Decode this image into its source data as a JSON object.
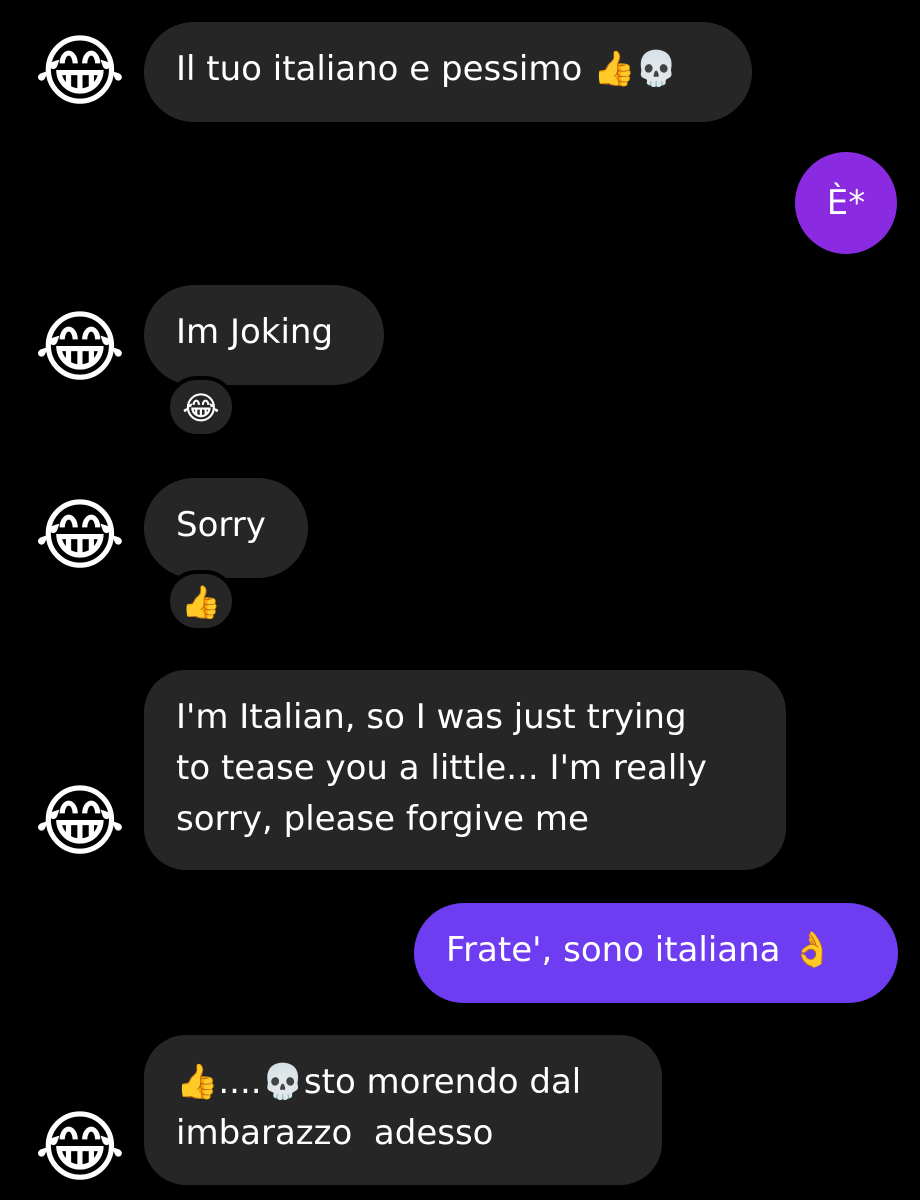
{
  "colors": {
    "background": "#000000",
    "incoming_bubble": "#262626",
    "outgoing_purple": "#8a2be2",
    "outgoing_violet": "#6e3df2"
  },
  "avatar_icon": "😂",
  "messages": [
    {
      "text": "Il tuo italiano e pessimo 👍💀"
    },
    {
      "text": "È*"
    },
    {
      "text": "Im Joking",
      "reaction": "😂"
    },
    {
      "text": "Sorry",
      "reaction": "👍"
    },
    {
      "text": "I'm Italian, so I was just trying\nto tease you a little... I'm really\nsorry, please forgive me"
    },
    {
      "text": "Frate', sono italiana 👌"
    },
    {
      "text": "👍....💀sto morendo dal\nimbarazzo  adesso"
    }
  ]
}
